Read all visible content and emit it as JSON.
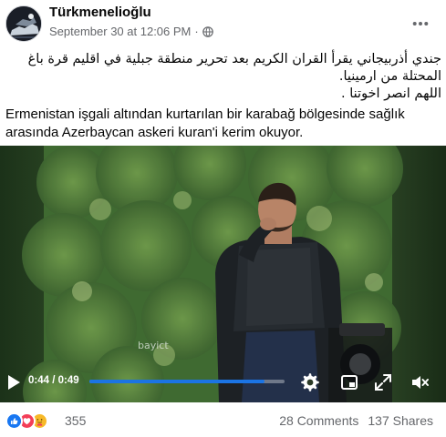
{
  "post": {
    "page_name": "Türkmenelioğlu",
    "timestamp": "September 30 at 12:06 PM",
    "separator": "·",
    "privacy_icon": "globe-icon",
    "more_icon": "ellipsis-icon"
  },
  "caption": {
    "arabic_line_1": "جندي أذربيجاني يقرأ القران الكريم بعد تحرير منطقة جبلية في اقليم قرة باغ",
    "arabic_line_2": "المحتلة من ارمينيا.",
    "arabic_line_3": "اللهم انصر اخوتنا .",
    "turkish": "Ermenistan işgali altından kurtarılan bir karabağ bölgesinde sağlık arasında Azerbaycan askeri kuran'i kerim okuyor."
  },
  "video": {
    "watermark": "bayict",
    "current_time": "0:44",
    "time_separator": " / ",
    "duration": "0:49",
    "progress_fraction": 0.898,
    "colors": {
      "progress": "#1b74e4"
    }
  },
  "footer": {
    "reactions": [
      "like-icon",
      "love-icon",
      "care-icon"
    ],
    "reaction_count": "355",
    "comments": "28 Comments",
    "shares": "137 Shares"
  }
}
